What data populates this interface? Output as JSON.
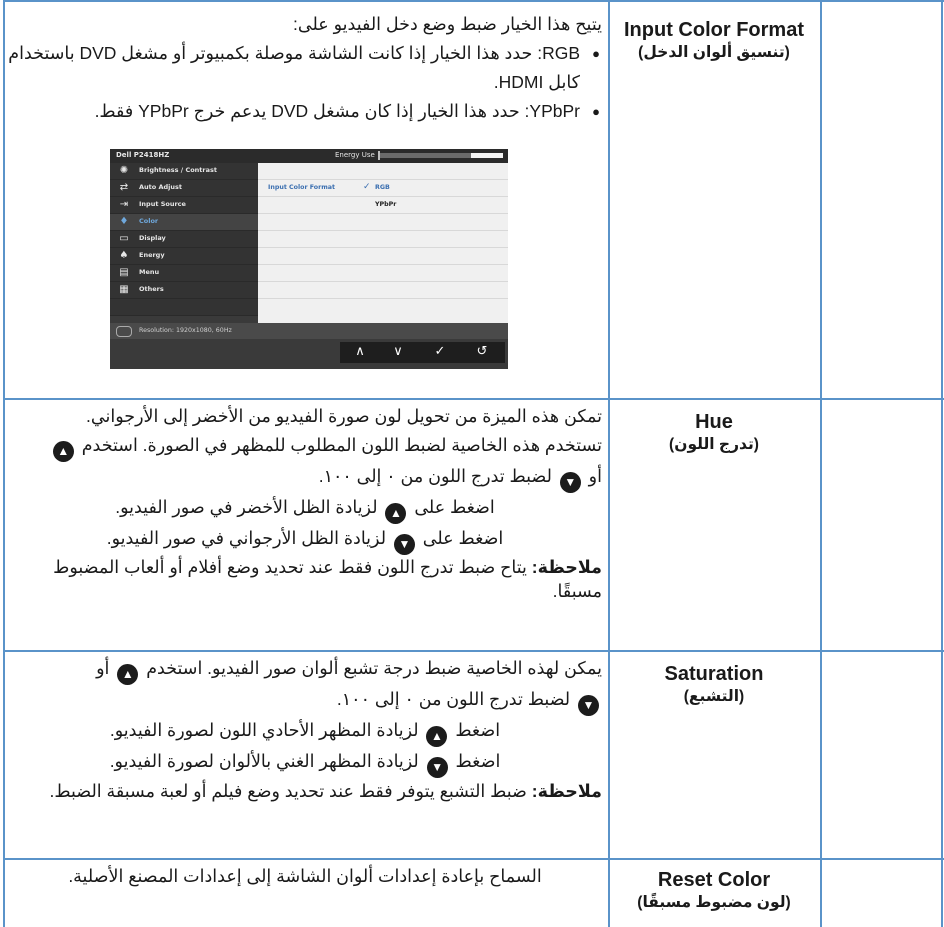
{
  "rows": [
    {
      "setting_en": "Input Color Format",
      "setting_ar": "(تنسيق ألوان الدخل)",
      "intro": "يتيح هذا الخيار ضبط وضع دخل الفيديو على:",
      "bullet1": "RGB: حدد هذا الخيار إذا كانت الشاشة موصلة بكمبيوتر أو مشغل DVD باستخدام كابل HDMI.",
      "bullet2": "YPbPr: حدد هذا الخيار إذا كان مشغل DVD يدعم خرج YPbPr فقط."
    },
    {
      "setting_en": "Hue",
      "setting_ar": "(تدرج اللون)",
      "line1": "تمكن هذه الميزة من تحويل لون صورة الفيديو من الأخضر إلى الأرجواني.",
      "line2a": "تستخدم هذه الخاصية لضبط اللون المطلوب للمظهر في الصورة. استخدم",
      "line2b": "أو",
      "line2c": "لضبط تدرج اللون من ٠ إلى ١٠٠.",
      "line3a": "اضغط على",
      "line3b": "لزيادة الظل الأخضر في صور الفيديو.",
      "line4a": "اضغط على",
      "line4b": "لزيادة الظل الأرجواني في صور الفيديو.",
      "note_label": "ملاحظة:",
      "note_text": "يتاح ضبط تدرج اللون فقط عند تحديد وضع أفلام أو ألعاب المضبوط مسبقًا."
    },
    {
      "setting_en": "Saturation",
      "setting_ar": "(التشبع)",
      "line1a": "يمكن لهذه الخاصية ضبط درجة تشبع ألوان صور الفيديو. استخدم",
      "line1b": "أو",
      "line1c": "لضبط تدرج اللون من ٠ إلى ١٠٠.",
      "line2a": "اضغط",
      "line2b": "لزيادة المظهر الأحادي اللون لصورة الفيديو.",
      "line3a": "اضغط",
      "line3b": "لزيادة المظهر الغني بالألوان لصورة الفيديو.",
      "note_label": "ملاحظة:",
      "note_text": "ضبط التشبع يتوفر فقط عند تحديد وضع فيلم أو لعبة مسبقة الضبط."
    },
    {
      "setting_en": "Reset Color",
      "setting_ar": "(لون مضبوط مسبقًا)",
      "line1": "السماح بإعادة إعدادات ألوان الشاشة إلى إعدادات المصنع الأصلية."
    }
  ],
  "osd": {
    "model": "Dell P2418HZ",
    "energy_label": "Energy Use",
    "energy_level": 0.26,
    "menu": [
      {
        "label": "Brightness / Contrast",
        "icon": "sun-icon"
      },
      {
        "label": "Auto Adjust",
        "icon": "auto-adjust-icon"
      },
      {
        "label": "Input Source",
        "icon": "input-source-icon"
      },
      {
        "label": "Color",
        "icon": "color-icon"
      },
      {
        "label": "Display",
        "icon": "display-icon"
      },
      {
        "label": "Energy",
        "icon": "energy-icon"
      },
      {
        "label": "Menu",
        "icon": "menu-icon"
      },
      {
        "label": "Others",
        "icon": "others-icon"
      }
    ],
    "active_item": "Color",
    "option_label": "Input Color Format",
    "option_rgb": "RGB",
    "option_ypbpr": "YPbPr",
    "resolution": "Resolution: 1920x1080, 60Hz",
    "colors": {
      "accent": "#3b6fb0",
      "table_border": "#5a93c9"
    }
  }
}
